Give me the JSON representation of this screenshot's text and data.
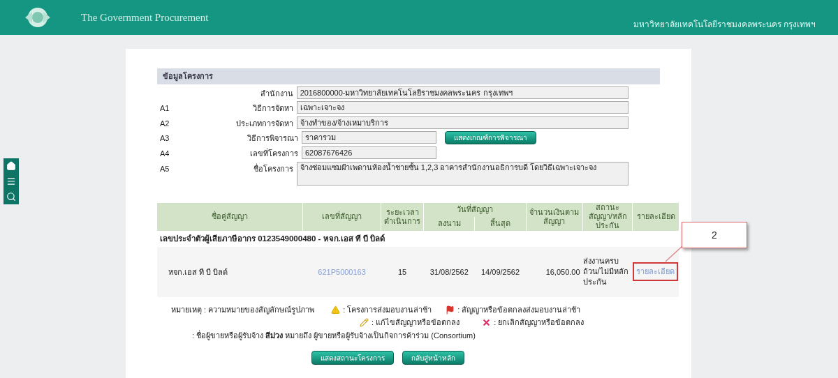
{
  "header": {
    "title": "The Government Procurement",
    "agency": "มหาวิทยาลัยเทคโนโลยีราชมงคลพระนคร กรุงเทพฯ"
  },
  "project": {
    "section_title": "ข้อมูลโครงการ",
    "fields": [
      {
        "label": "สำนักงาน",
        "value": "2016800000-มหาวิทยาลัยเทคโนโลยีราชมงคลพระนคร กรุงเทพฯ",
        "kind": "wide"
      },
      {
        "code": "A1",
        "label": "วิธีการจัดหา",
        "value": "เฉพาะเจาะจง",
        "kind": "wide"
      },
      {
        "code": "A2",
        "label": "ประเภทการจัดหา",
        "value": "จ้างทำของ/จ้างเหมาบริการ",
        "kind": "wide"
      },
      {
        "code": "A3",
        "label": "วิธีการพิจารณา",
        "value": "ราคารวม",
        "kind": "short",
        "button": "แสดงเกณฑ์การพิจารณา"
      },
      {
        "code": "A4",
        "label": "เลขที่โครงการ",
        "value": "62087676426",
        "kind": "short"
      },
      {
        "code": "A5",
        "label": "ชื่อโครงการ",
        "value": "จ้างซ่อมแซมฝ้าเพดานห้องน้ำชายชั้น 1,2,3 อาคารสำนักงานอธิการบดี โดยวิธีเฉพาะเจาะจง",
        "kind": "area"
      }
    ]
  },
  "contracts": {
    "columns": {
      "party": "ชื่อคู่สัญญา",
      "number": "เลขที่สัญญา",
      "duration": "ระยะเวลาดำเนินการ",
      "date": "วันที่สัญญา",
      "signed": "ลงนาม",
      "end": "สิ้นสุด",
      "amount": "จำนวนเงินตามสัญญา",
      "status": "สถานะสัญญา/หลักประกัน",
      "detail": "รายละเอียด"
    },
    "group": "เลขประจำตัวผู้เสียภาษีอากร 0123549000480 - หจก.เอส ที บี บิลด์",
    "rows": [
      {
        "party": "หจก.เอส ที บี บิลด์",
        "number": "621P5000163",
        "duration": "15",
        "signed": "31/08/2562",
        "end": "14/09/2562",
        "amount": "16,050.00",
        "status": "ส่งงานครบถ้วน/ไม่มีหลักประกัน",
        "detail": "รายละเอียด",
        "highlighted": true
      }
    ]
  },
  "legend": {
    "title": "หมายเหตุ : ความหมายของสัญลักษณ์รูปภาพ",
    "items": [
      {
        "kind": "warning",
        "text": ": โครงการส่งมอบงานล่าช้า"
      },
      {
        "kind": "flag",
        "text": ": สัญญาหรือข้อตกลงส่งมอบงานล่าช้า"
      },
      {
        "kind": "pencil",
        "text": ": แก้ไขสัญญาหรือข้อตกลง"
      },
      {
        "kind": "cancel",
        "text": ": ยกเลิกสัญญาหรือข้อตกลง"
      }
    ],
    "note": ": ชื่อผู้ขายหรือผู้รับจ้าง **สีม่วง** หมายถึง ผู้ขายหรือผู้รับจ้างเป็นกิจการค้าร่วม (Consortium)"
  },
  "buttons": [
    "แสดงสถานะโครงการ",
    "กลับสู่หน้าหลัก"
  ],
  "callout": "2"
}
